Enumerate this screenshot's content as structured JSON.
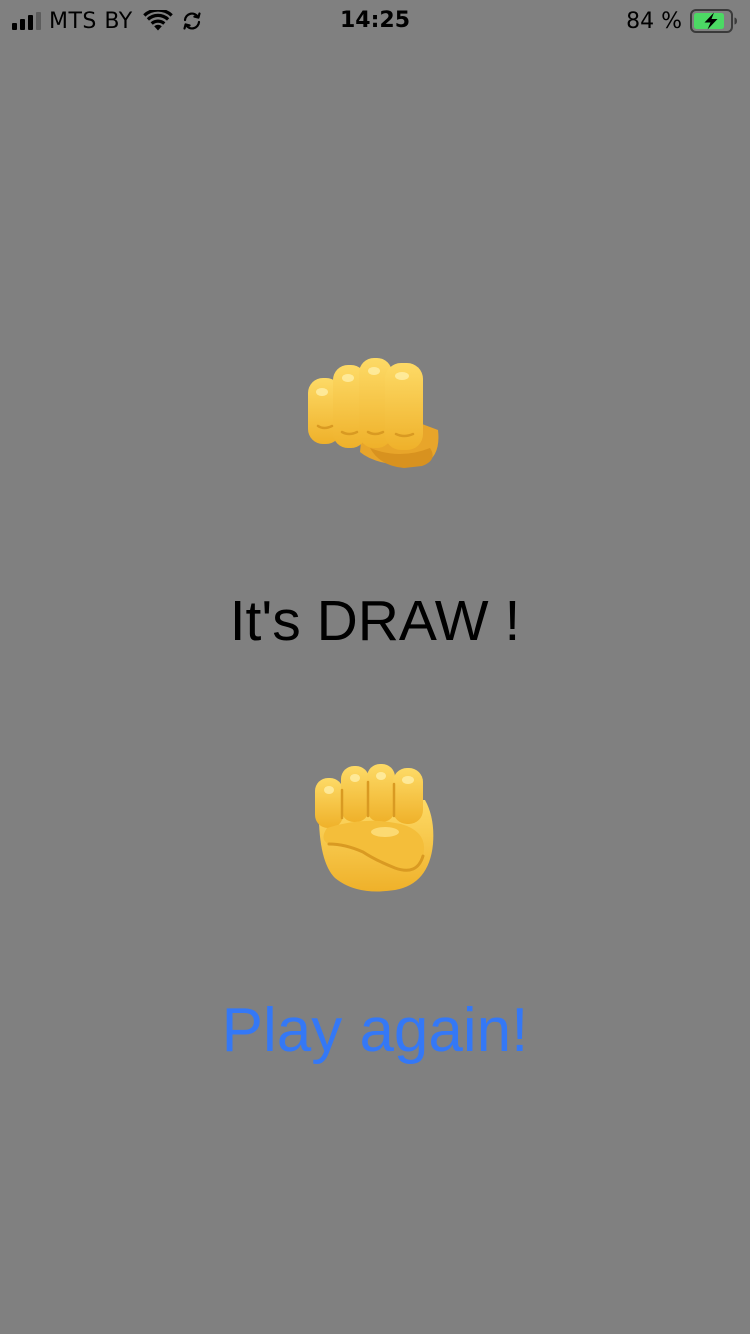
{
  "status_bar": {
    "carrier": "MTS BY",
    "time": "14:25",
    "battery_percent": "84 %",
    "signal_bars_filled": 3,
    "signal_bars_total": 4,
    "battery_level": 0.84,
    "charging": true,
    "icons": [
      "cellular-signal-icon",
      "wifi-icon",
      "sync-icon",
      "battery-charging-icon"
    ]
  },
  "game": {
    "opponent_choice": "oncoming-fist-icon",
    "result_text": "It's DRAW !",
    "player_choice": "raised-fist-icon",
    "play_again_label": "Play again!"
  },
  "colors": {
    "background": "#808080",
    "link_blue": "#3478F6",
    "emoji_yellow": "#F6C544",
    "battery_green": "#4CD964"
  }
}
